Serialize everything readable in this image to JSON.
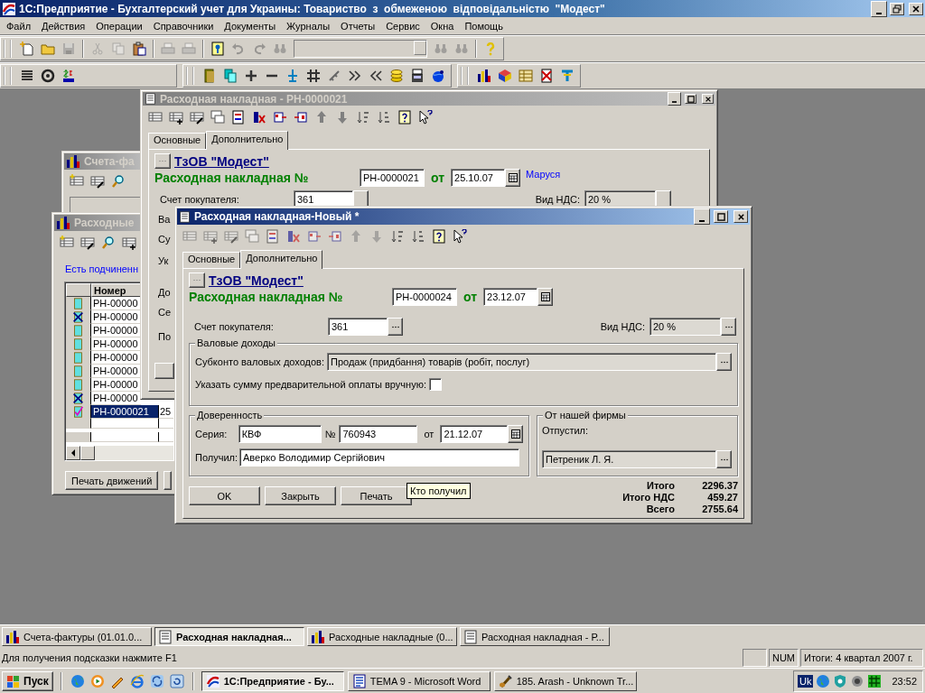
{
  "app_window": {
    "title": "1С:Предприятие - Бухгалтерский учет для Украины: Товариство  з  обмеженою  відповідальністю  \"Модест\""
  },
  "menu": [
    "Файл",
    "Действия",
    "Операции",
    "Справочники",
    "Документы",
    "Журналы",
    "Отчеты",
    "Сервис",
    "Окна",
    "Помощь"
  ],
  "invoices_window": {
    "title": "Счета-фа",
    "active": false
  },
  "list_window": {
    "title": "Расходные",
    "active": false,
    "note": "Есть подчиненн",
    "column": "Номер",
    "rows": [
      {
        "number": "РН-00000",
        "kind": "document",
        "selected": false
      },
      {
        "number": "РН-00000",
        "kind": "deleted",
        "selected": false
      },
      {
        "number": "РН-00000",
        "kind": "document",
        "selected": false
      },
      {
        "number": "РН-00000",
        "kind": "document",
        "selected": false
      },
      {
        "number": "РН-00000",
        "kind": "document",
        "selected": false
      },
      {
        "number": "РН-00000",
        "kind": "document",
        "selected": false
      },
      {
        "number": "РН-00000",
        "kind": "document",
        "selected": false
      },
      {
        "number": "РН-00000",
        "kind": "deleted",
        "selected": false
      },
      {
        "number": "РН-0000021",
        "date": "25",
        "kind": "posted",
        "selected": true
      }
    ],
    "buttons": [
      "Печать движений"
    ]
  },
  "back_document": {
    "title": "Расходная накладная - РН-0000021",
    "active": false,
    "tabs": [
      {
        "label": "Основные",
        "selected": false
      },
      {
        "label": "Дополнительно",
        "selected": true
      }
    ],
    "organization": "ТзОВ \"Модест\"",
    "doc_label": "Расходная накладная №",
    "number": "РН-0000021",
    "date_label": "от",
    "date": "25.10.07",
    "author": "Маруся",
    "account_label": "Счет покупателя:",
    "account": "361",
    "vat_label": "Вид НДС:",
    "vat": "20 %",
    "fragments": [
      "Ва",
      "Су",
      "Ук",
      "До",
      "Се",
      "По"
    ]
  },
  "front_document": {
    "title": "Расходная накладная-Новый *",
    "active": true,
    "tabs": [
      {
        "label": "Основные",
        "selected": false
      },
      {
        "label": "Дополнительно",
        "selected": true
      }
    ],
    "organization": "ТзОВ \"Модест\"",
    "doc_label": "Расходная накладная №",
    "number": "РН-0000024",
    "date_label": "от",
    "date": "23.12.07",
    "account_label": "Счет покупателя:",
    "account": "361",
    "vat_label": "Вид НДС:",
    "vat": "20 %",
    "gross_income": {
      "legend": "Валовые доходы",
      "subconto_label": "Субконто валовых доходов:",
      "subconto": "Продаж (придбання) товарів (робіт, послуг)",
      "prepay_label": "Указать сумму предварительной оплаты вручную:",
      "prepay_checked": false
    },
    "proxy": {
      "legend": "Доверенность",
      "series_label": "Серия:",
      "series": "КВФ",
      "number_label": "№",
      "number": "760943",
      "date_label": "от",
      "date": "21.12.07",
      "receiver_label": "Получил:",
      "receiver": "Аверко Володимир Сергійович"
    },
    "issuer": {
      "legend": "От нашей фирмы",
      "label": "Отпустил:",
      "value": "Петреник Л. Я."
    },
    "buttons": [
      "OK",
      "Закрыть",
      "Печать"
    ],
    "tooltip": "Кто получил",
    "totals": [
      {
        "label": "Итого",
        "value": "2296.37"
      },
      {
        "label": "Итого НДС",
        "value": "459.27"
      },
      {
        "label": "Всего",
        "value": "2755.64"
      }
    ]
  },
  "window_tabs": [
    {
      "label": "Счета-фактуры (01.01.0...",
      "kind": "journal",
      "selected": false
    },
    {
      "label": "Расходная накладная...",
      "kind": "document",
      "selected": true
    },
    {
      "label": "Расходные накладные (0...",
      "kind": "journal",
      "selected": false
    },
    {
      "label": "Расходная накладная - Р...",
      "kind": "document",
      "selected": false
    }
  ],
  "status_bar": {
    "hint": "Для получения подсказки нажмите F1",
    "indicator": "NUM",
    "period": "Итоги: 4 квартал 2007 г."
  },
  "taskbar": {
    "start": "Пуск",
    "tasks": [
      {
        "label": "1С:Предприятие - Бу...",
        "kind": "onec",
        "selected": true
      },
      {
        "label": "TEMA 9 - Microsoft Word",
        "kind": "word",
        "selected": false
      },
      {
        "label": "185. Arash - Unknown Tr...",
        "kind": "player",
        "selected": false
      }
    ],
    "language": "Uk",
    "clock": "23:52"
  }
}
